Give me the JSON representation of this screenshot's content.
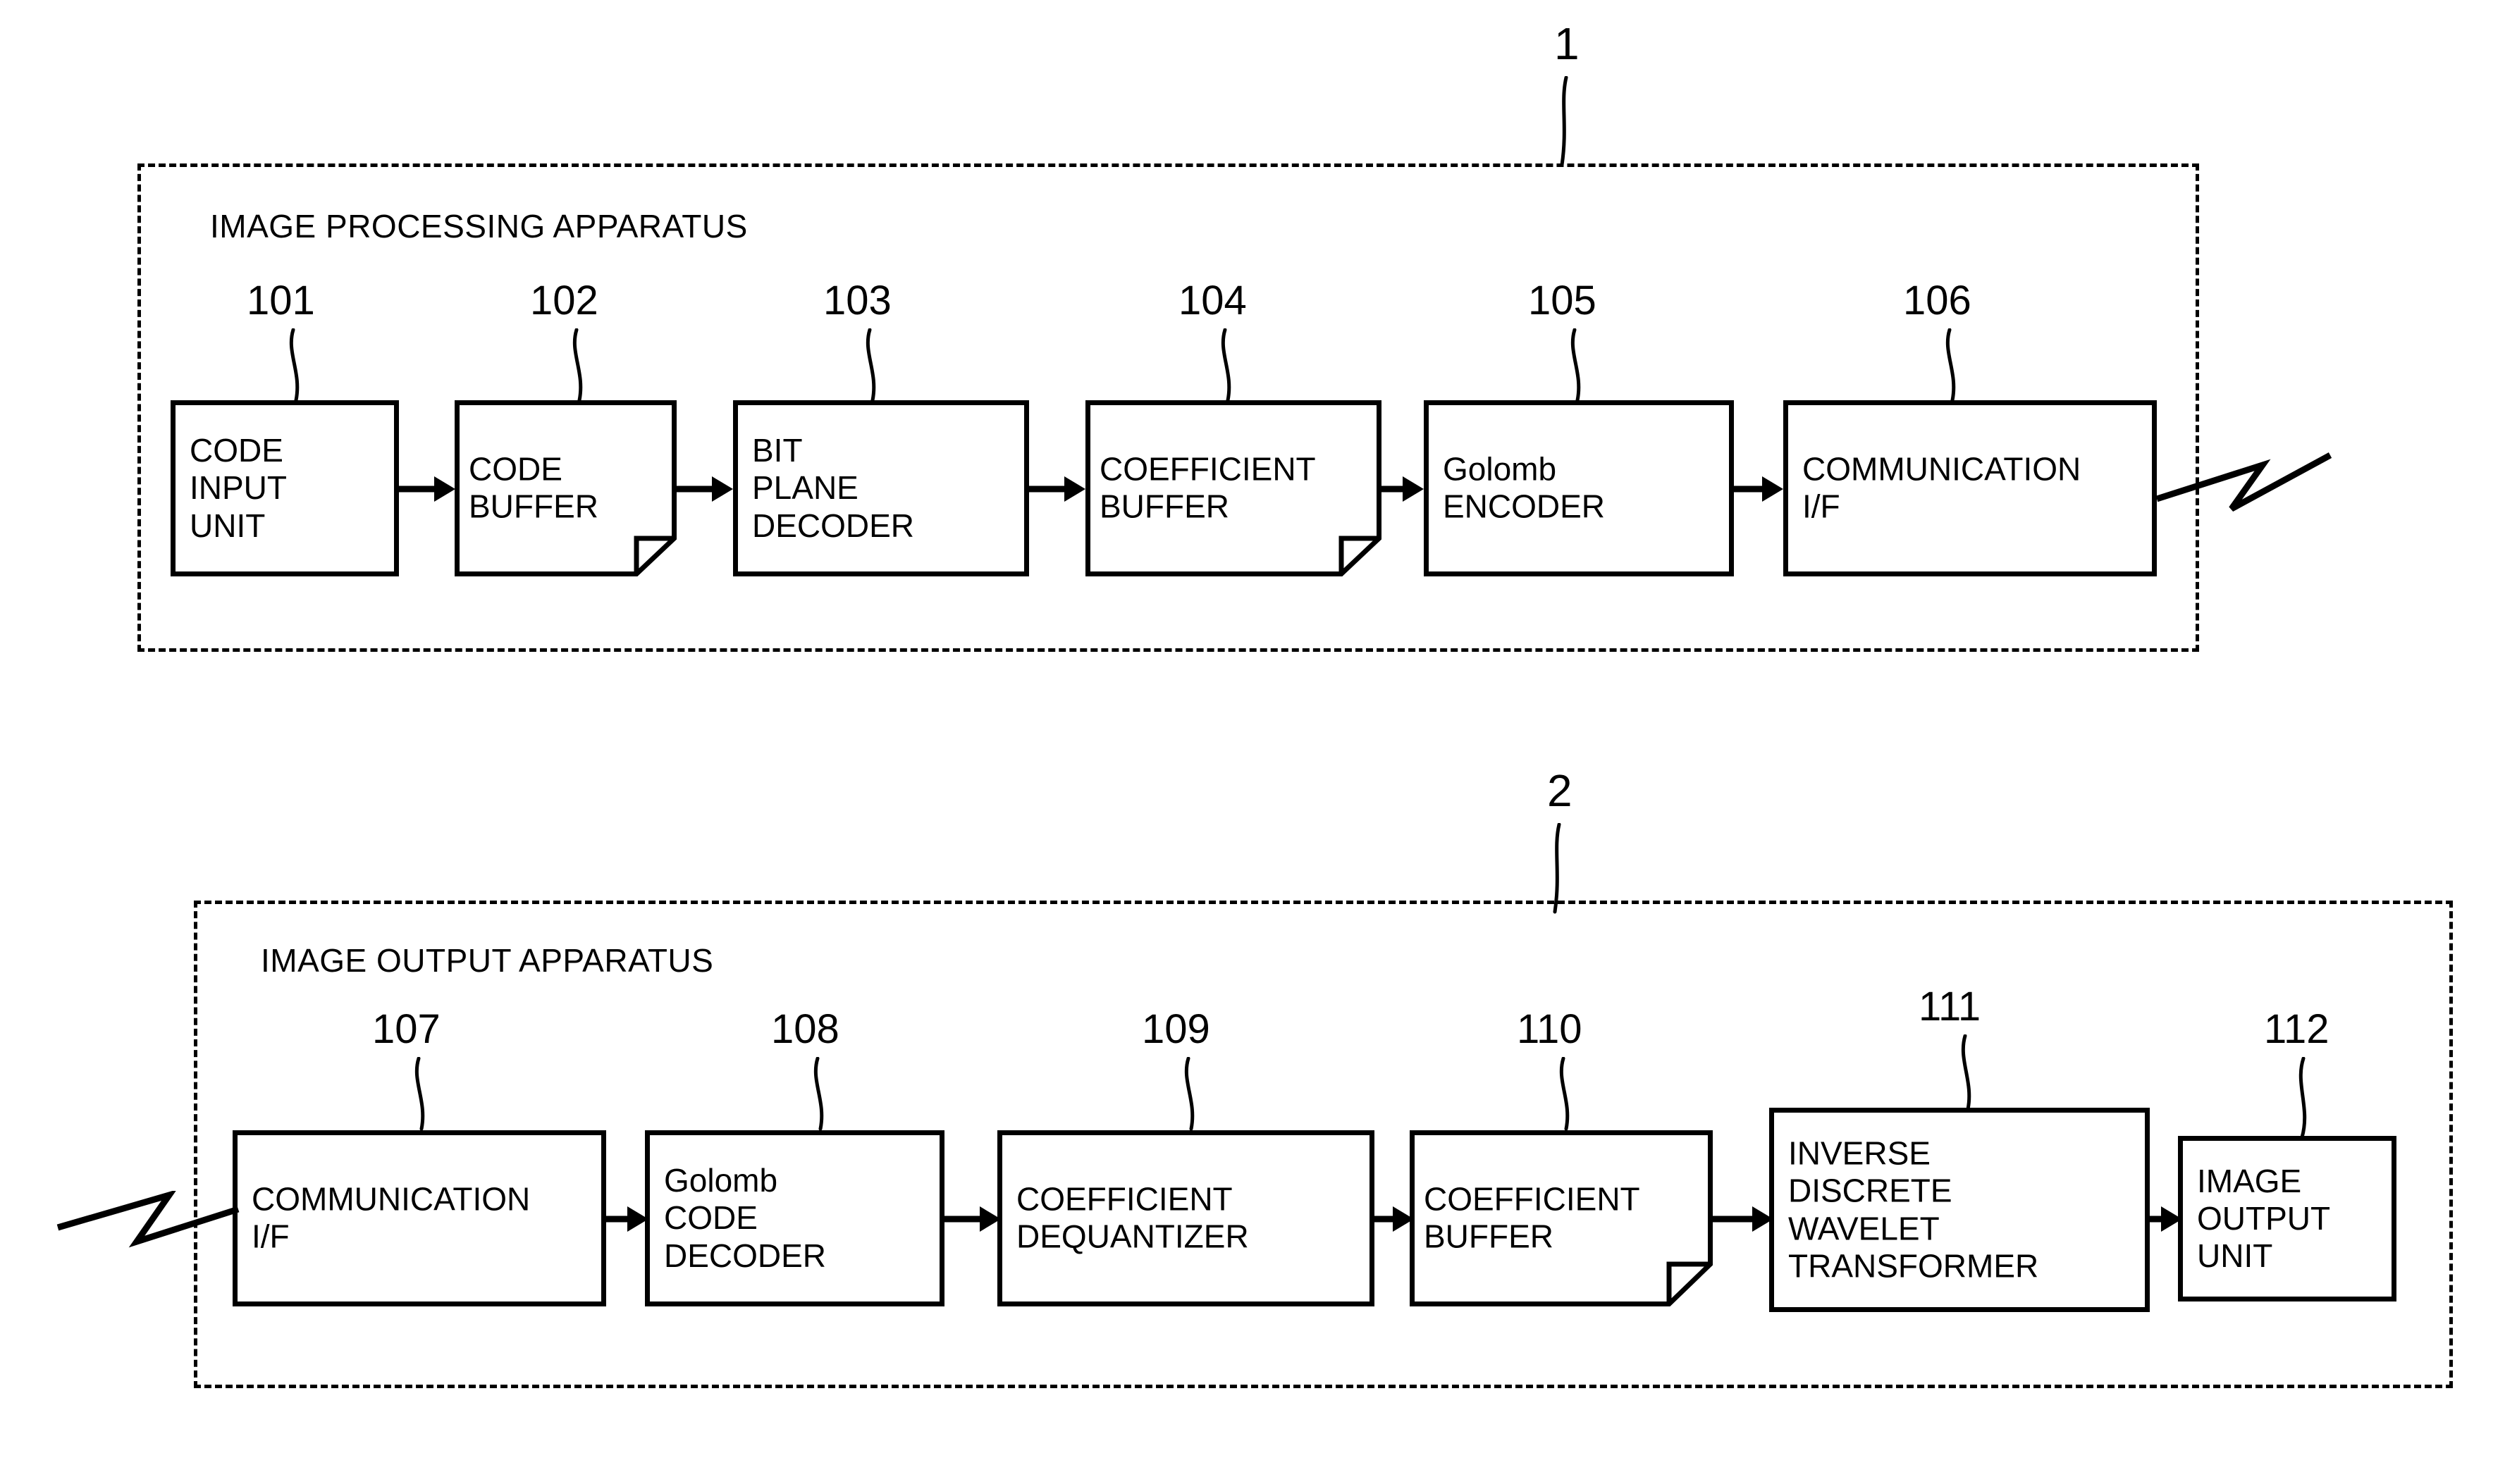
{
  "figure": {
    "apparatus1": {
      "ref": "1",
      "title": "IMAGE PROCESSING APPARATUS"
    },
    "apparatus2": {
      "ref": "2",
      "title": "IMAGE OUTPUT APPARATUS"
    }
  },
  "blocks_row1": [
    {
      "ref": "101",
      "label": "CODE\nINPUT\nUNIT",
      "style": "plain"
    },
    {
      "ref": "102",
      "label": "CODE\nBUFFER",
      "style": "dogear"
    },
    {
      "ref": "103",
      "label": "BIT\nPLANE\nDECODER",
      "style": "plain"
    },
    {
      "ref": "104",
      "label": "COEFFICIENT\nBUFFER",
      "style": "dogear"
    },
    {
      "ref": "105",
      "label": "Golomb\nENCODER",
      "style": "plain"
    },
    {
      "ref": "106",
      "label": "COMMUNICATION\nI/F",
      "style": "plain"
    }
  ],
  "blocks_row2": [
    {
      "ref": "107",
      "label": "COMMUNICATION\nI/F",
      "style": "plain"
    },
    {
      "ref": "108",
      "label": "Golomb\nCODE\nDECODER",
      "style": "plain"
    },
    {
      "ref": "109",
      "label": "COEFFICIENT\nDEQUANTIZER",
      "style": "plain"
    },
    {
      "ref": "110",
      "label": "COEFFICIENT\nBUFFER",
      "style": "dogear"
    },
    {
      "ref": "111",
      "label": "INVERSE\nDISCRETE\nWAVELET\nTRANSFORMER",
      "style": "plain"
    },
    {
      "ref": "112",
      "label": "IMAGE\nOUTPUT\nUNIT",
      "style": "plain"
    }
  ],
  "colors": {
    "ink": "#000000",
    "paper": "#ffffff"
  }
}
